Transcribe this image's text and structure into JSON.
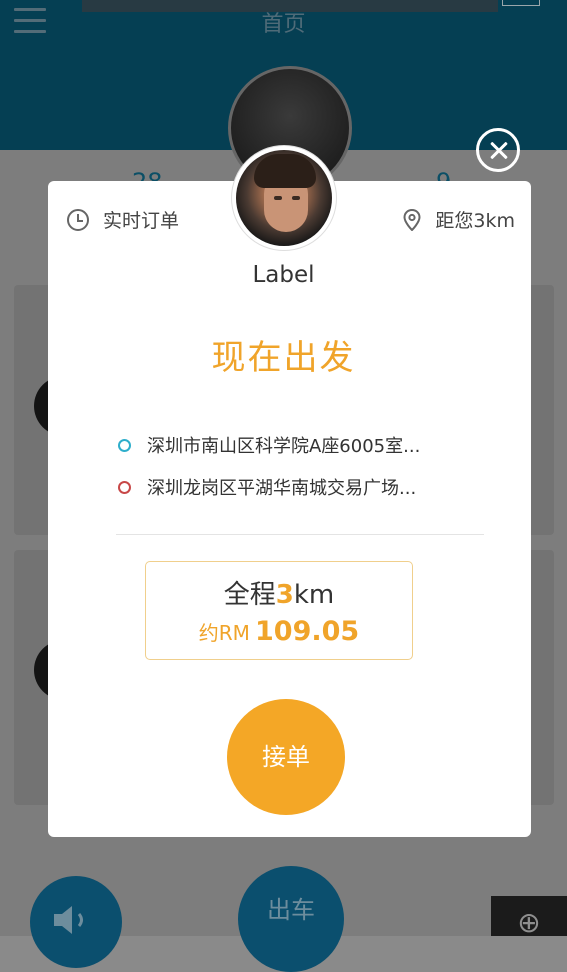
{
  "background": {
    "header_title": "首页",
    "stat_left": "28",
    "stat_right": "9",
    "bottom_button": "出车"
  },
  "order": {
    "type_label": "实时订单",
    "distance_label": "距您3km"
  },
  "passenger": {
    "name": "Label"
  },
  "status_text": "现在出发",
  "route": {
    "from": "深圳市南山区科学院A座6005室...",
    "to": "深圳龙岗区平湖华南城交易广场..."
  },
  "trip": {
    "prefix": "全程",
    "distance_value": "3",
    "distance_unit": "km",
    "fare_prefix": "约RM",
    "fare_amount": "109.05"
  },
  "accept_button": "接单",
  "colors": {
    "accent": "#f4a726",
    "header": "#053f53",
    "origin_dot": "#2eaecb",
    "destination_dot": "#c84848"
  }
}
